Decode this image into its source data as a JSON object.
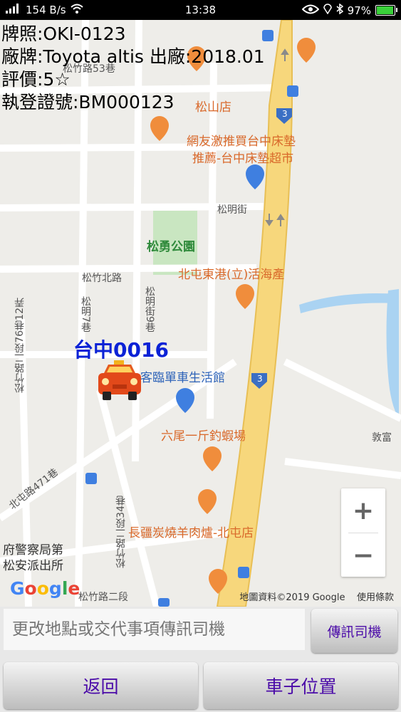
{
  "status_bar": {
    "speed": "154 B/s",
    "time": "13:38",
    "battery": "97%"
  },
  "vehicle_info": {
    "plate": "牌照:OKI-0123",
    "model": "廠牌:Toyota altis 出廠:2018.01",
    "rating": "評價:5☆",
    "registration": "執登證號:BM000123"
  },
  "map": {
    "car_label": "台中0016",
    "labels": {
      "songshan_store": "松山店",
      "mattress_1": "網友激推買台中床墊",
      "mattress_2": "推薦-台中床墊超市",
      "songming_st": "松明街",
      "park": "松勇公園",
      "songzhu_n_rd": "松竹北路",
      "songming_st9": "松明街9巷",
      "beitun_port": "北屯東港(立)活海產",
      "life_hall": "客臨單車生活館",
      "shrimp": "六尾一斤釣蝦場",
      "dunfu": "敦富",
      "road_76": "松竹路二段76巷12弄",
      "road_7lane": "松明7巷",
      "beitun_471": "北屯路471巷",
      "road_34": "松竹路二段34巷",
      "police_1": "府警察局第",
      "police_2": "松安派出所",
      "bbq": "長疆炭燒羊肉爐-北屯店",
      "songzhu_2": "松竹路二段",
      "lane_53": "松竹路53巷",
      "road3a": "3",
      "road3b": "3"
    },
    "zoom_in": "+",
    "zoom_out": "−",
    "attribution": "地圖資料©2019 Google",
    "terms": "使用條款",
    "logo": "Google"
  },
  "message": {
    "placeholder": "更改地點或交代事項傳訊司機"
  },
  "buttons": {
    "send": "傳訊司機",
    "back": "返回",
    "car_location": "車子位置"
  }
}
